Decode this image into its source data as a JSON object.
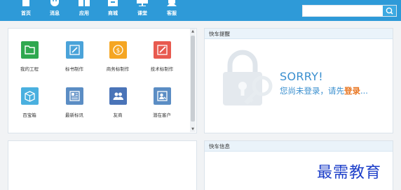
{
  "nav": {
    "items": [
      {
        "label": "首页",
        "icon": "home-icon"
      },
      {
        "label": "消息",
        "icon": "message-icon"
      },
      {
        "label": "应用",
        "icon": "apps-icon"
      },
      {
        "label": "商城",
        "icon": "store-icon"
      },
      {
        "label": "课堂",
        "icon": "classroom-icon"
      },
      {
        "label": "客服",
        "icon": "customer-service-icon"
      }
    ]
  },
  "search": {
    "placeholder": "",
    "button_icon": "search-icon"
  },
  "apps": {
    "tiles": [
      {
        "label": "我的工程",
        "icon": "folder-icon",
        "color": "#2fa84f"
      },
      {
        "label": "标书制作",
        "icon": "edit-icon",
        "color": "#4aa3d9"
      },
      {
        "label": "商务标制作",
        "icon": "coin-icon",
        "color": "#f5a623"
      },
      {
        "label": "技术标制作",
        "icon": "pencil-icon",
        "color": "#e85a4f"
      },
      {
        "label": "百宝箱",
        "icon": "box-icon",
        "color": "#4ab0df"
      },
      {
        "label": "最新标讯",
        "icon": "news-icon",
        "color": "#5b8dc4"
      },
      {
        "label": "友商",
        "icon": "partners-icon",
        "color": "#4a74b8"
      },
      {
        "label": "潜在客户",
        "icon": "customer-search-icon",
        "color": "#5b8dc4"
      }
    ]
  },
  "reminder": {
    "title": "快车提醒",
    "sorry": "SORRY!",
    "message_prefix": "您尚未登录，请先",
    "login_link": "登录",
    "message_suffix": "..."
  },
  "info": {
    "title": "快车信息"
  },
  "watermark": "最需教育"
}
